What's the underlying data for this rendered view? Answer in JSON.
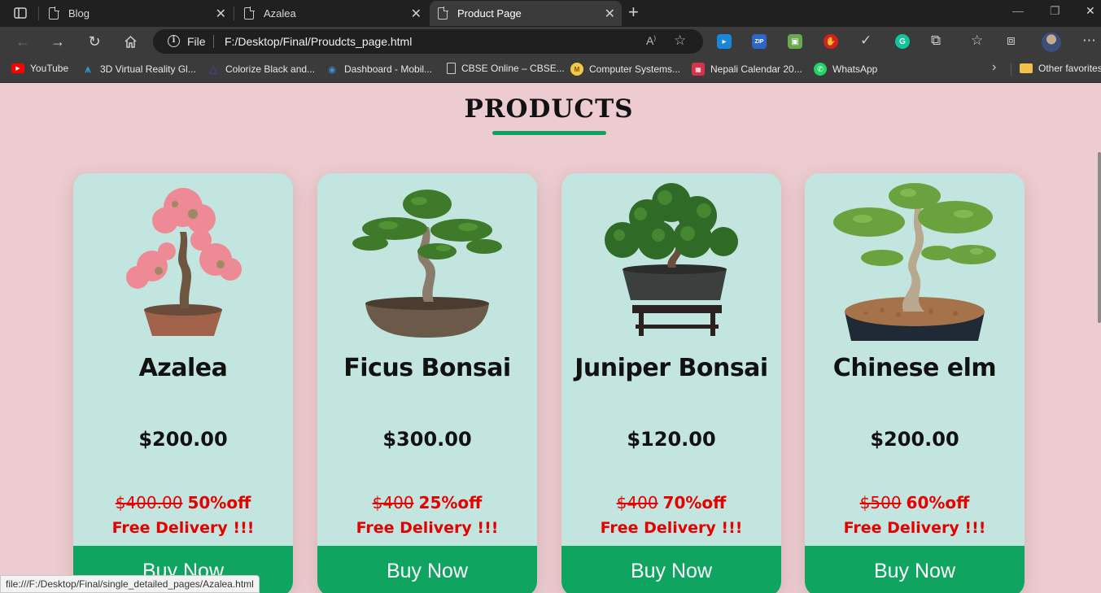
{
  "tabs": [
    {
      "title": "Blog",
      "active": false
    },
    {
      "title": "Azalea",
      "active": false
    },
    {
      "title": "Product Page",
      "active": true
    }
  ],
  "address": {
    "scheme_label": "File",
    "url": "F:/Desktop/Final/Proudcts_page.html"
  },
  "bookmarks": [
    {
      "label": "YouTube",
      "icon": "youtube-icon",
      "color": "#ff0000"
    },
    {
      "label": "3D Virtual Reality Gl...",
      "icon": "vr-icon",
      "color": "#2b9bd6"
    },
    {
      "label": "Colorize Black and...",
      "icon": "colorize-icon",
      "color": "#5a3fb0"
    },
    {
      "label": "Dashboard - Mobil...",
      "icon": "dashboard-icon",
      "color": "#3a8fd8"
    },
    {
      "label": "CBSE Online – CBSE...",
      "icon": "page-icon",
      "color": "#cccccc"
    },
    {
      "label": "Computer Systems...",
      "icon": "computer-systems-icon",
      "color": "#f2c84b"
    },
    {
      "label": "Nepali Calendar 20...",
      "icon": "calendar-icon",
      "color": "#d6334a"
    },
    {
      "label": "WhatsApp",
      "icon": "whatsapp-icon",
      "color": "#25d366"
    },
    {
      "label": "Other favorites",
      "icon": "folder-icon",
      "color": "#f0c14b"
    }
  ],
  "page": {
    "heading": "PRODUCTS",
    "accent_color": "#10a461",
    "products": [
      {
        "name": "Azalea",
        "price": "$200.00",
        "old_price": "$400.00",
        "discount": "50%off",
        "delivery": "Free Delivery !!!",
        "buy_label": "Buy Now",
        "image": "azalea-bonsai-image"
      },
      {
        "name": "Ficus Bonsai",
        "price": "$300.00",
        "old_price": "$400",
        "discount": "25%off",
        "delivery": "Free Delivery !!!",
        "buy_label": "Buy Now",
        "image": "ficus-bonsai-image"
      },
      {
        "name": "Juniper Bonsai",
        "price": "$120.00",
        "old_price": "$400",
        "discount": "70%off",
        "delivery": "Free Delivery !!!",
        "buy_label": "Buy Now",
        "image": "juniper-bonsai-image"
      },
      {
        "name": "Chinese elm",
        "price": "$200.00",
        "old_price": "$500",
        "discount": "60%off",
        "delivery": "Free Delivery !!!",
        "buy_label": "Buy Now",
        "image": "chinese-elm-bonsai-image"
      }
    ]
  },
  "status_url": "file:///F:/Desktop/Final/single_detailed_pages/Azalea.html"
}
